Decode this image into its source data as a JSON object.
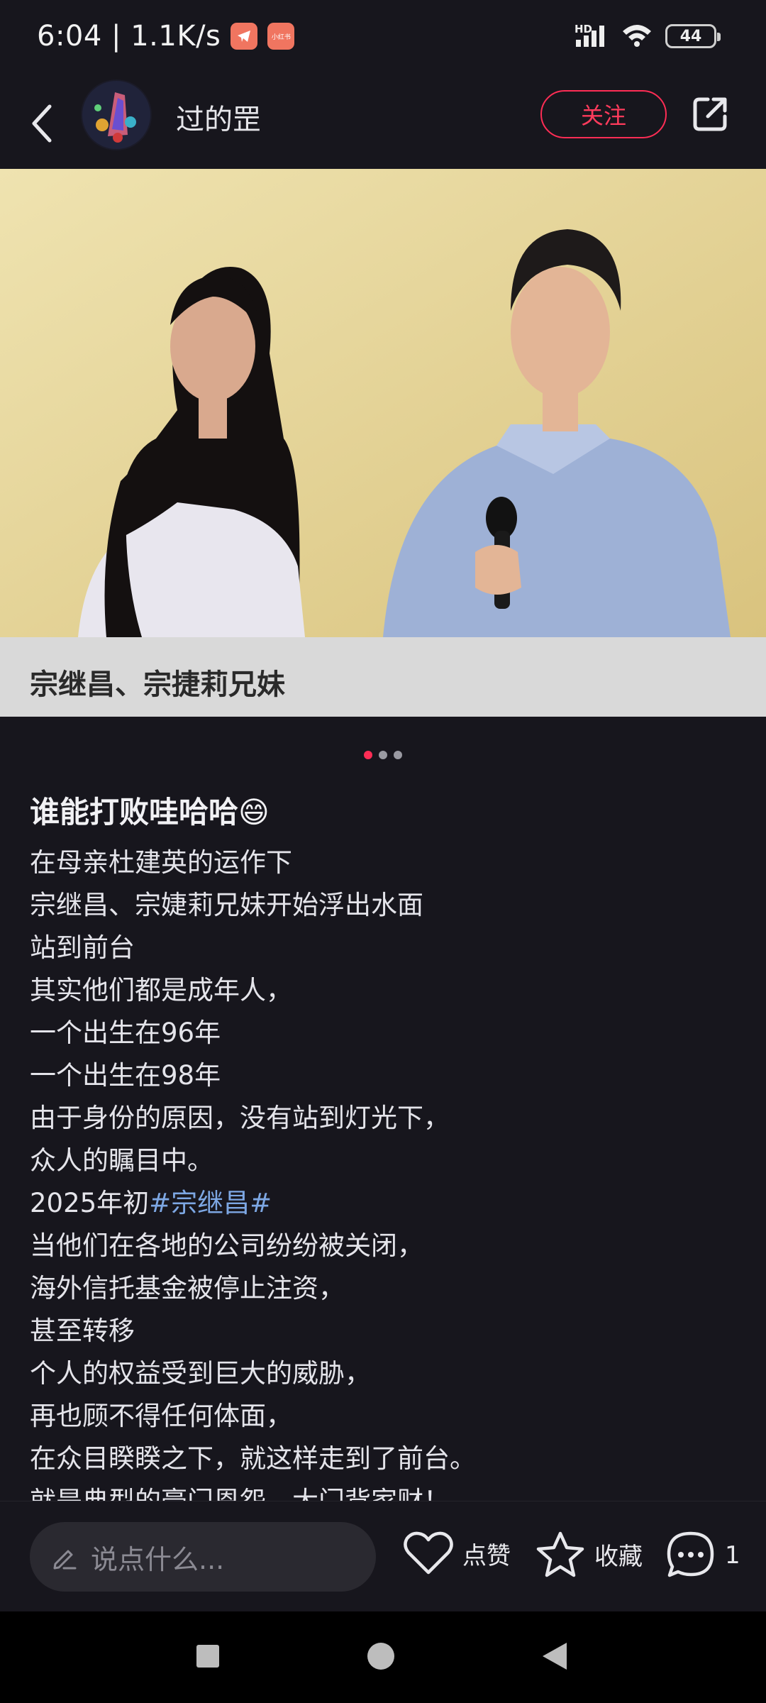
{
  "status_bar": {
    "time": "6:04",
    "speed": "1.1K/s",
    "battery": "44",
    "signal_label": "HD",
    "badge2_text": "小红书"
  },
  "header": {
    "author_name": "过的罡",
    "follow_label": "关注"
  },
  "media": {
    "caption": "宗继昌、宗捷莉兄妹",
    "page_count": 3,
    "active_page": 1
  },
  "post": {
    "title": "谁能打败哇哈哈😄",
    "lines": [
      "在母亲杜建英的运作下",
      "宗继昌、宗婕莉兄妹开始浮出水面",
      "站到前台",
      "其实他们都是成年人，",
      "一个出生在96年",
      "一个出生在98年",
      "由于身份的原因，没有站到灯光下，",
      "众人的瞩目中。"
    ],
    "line9_prefix": "2025年初",
    "hashtag": "#宗继昌#",
    "lines_after": [
      "当他们在各地的公司纷纷被关闭，",
      "海外信托基金被停止注资，",
      "甚至转移",
      "个人的权益受到巨大的威胁，",
      "再也顾不得任何体面，",
      "在众目睽睽之下，就这样走到了前台。",
      "就是典型的豪门恩怨，大门背家财！"
    ]
  },
  "bottom_bar": {
    "comment_placeholder": "说点什么...",
    "like_label": "点赞",
    "collect_label": "收藏",
    "comment_count": "1"
  },
  "colors": {
    "accent": "#ff2d55",
    "background": "#17161d",
    "hashtag": "#7da7e3"
  }
}
